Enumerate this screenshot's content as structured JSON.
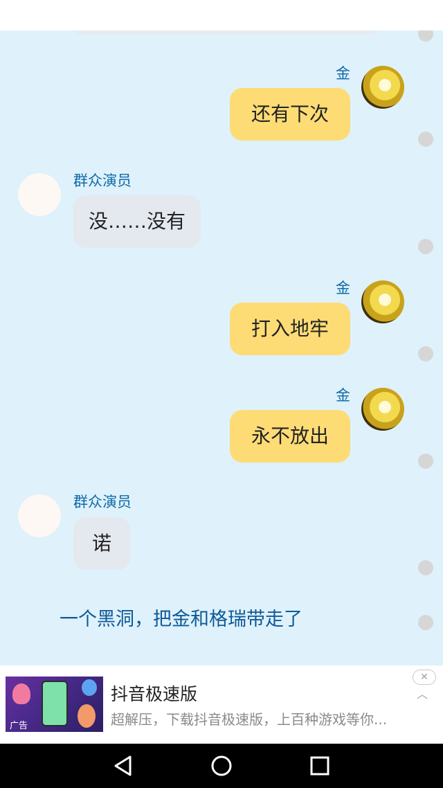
{
  "conversation": {
    "messages": [
      {
        "sender": "金",
        "side": "right",
        "text": "还有下次",
        "avatar": "character-avatar"
      },
      {
        "sender": "群众演员",
        "side": "left",
        "text": "没……没有",
        "avatar": "blank-avatar"
      },
      {
        "sender": "金",
        "side": "right",
        "text": "打入地牢",
        "avatar": "character-avatar"
      },
      {
        "sender": "金",
        "side": "right",
        "text": "永不放出",
        "avatar": "character-avatar"
      },
      {
        "sender": "群众演员",
        "side": "left",
        "text": "诺",
        "avatar": "blank-avatar"
      }
    ],
    "narration": "一个黑洞，把金和格瑞带走了"
  },
  "ad": {
    "title": "抖音极速版",
    "description": "超解压，下载抖音极速版，上百种游戏等你...",
    "tag": "广告",
    "close_icon": "close-icon",
    "collapse_icon": "chevron-up-icon"
  },
  "navbar": {
    "back_icon": "back-triangle-icon",
    "home_icon": "home-circle-icon",
    "recents_icon": "recents-square-icon"
  },
  "colors": {
    "chat_background": "#dff1fb",
    "my_bubble": "#fddc76",
    "other_bubble": "#e4e8ef",
    "name_text": "#0e6aa8",
    "narration_text": "#0e5a98"
  }
}
